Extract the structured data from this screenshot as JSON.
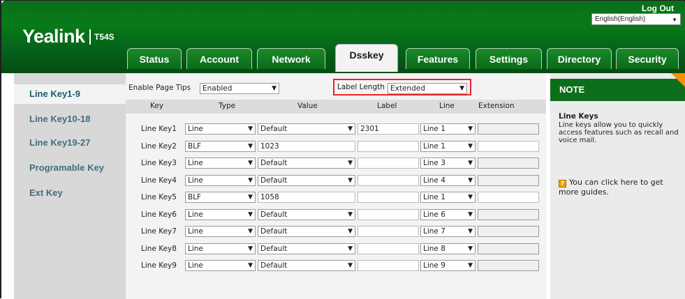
{
  "header": {
    "brand": "Yealink",
    "model": "T54S",
    "logout": "Log Out",
    "language": "English(English)"
  },
  "tabs": [
    {
      "label": "Status"
    },
    {
      "label": "Account"
    },
    {
      "label": "Network"
    },
    {
      "label": "Dsskey",
      "active": true
    },
    {
      "label": "Features"
    },
    {
      "label": "Settings"
    },
    {
      "label": "Directory"
    },
    {
      "label": "Security"
    }
  ],
  "sidebar": {
    "items": [
      {
        "label": "Line Key1-9",
        "active": true
      },
      {
        "label": "Line Key10-18"
      },
      {
        "label": "Line Key19-27"
      },
      {
        "label": "Programable Key"
      },
      {
        "label": "Ext Key"
      }
    ]
  },
  "settings": {
    "page_tips_label": "Enable Page Tips",
    "page_tips_value": "Enabled",
    "label_length_label": "Label Length",
    "label_length_value": "Extended"
  },
  "table": {
    "headers": [
      "Key",
      "Type",
      "Value",
      "Label",
      "Line",
      "Extension"
    ],
    "rows": [
      {
        "key": "Line Key1",
        "type": "Line",
        "value": "Default",
        "value_select": true,
        "label": "2301",
        "line": "Line 1",
        "ext_disabled": true
      },
      {
        "key": "Line Key2",
        "type": "BLF",
        "value": "1023",
        "value_select": false,
        "label": "",
        "line": "Line 1",
        "ext_disabled": false
      },
      {
        "key": "Line Key3",
        "type": "Line",
        "value": "Default",
        "value_select": true,
        "label": "",
        "line": "Line 3",
        "ext_disabled": true
      },
      {
        "key": "Line Key4",
        "type": "Line",
        "value": "Default",
        "value_select": true,
        "label": "",
        "line": "Line 4",
        "ext_disabled": true
      },
      {
        "key": "Line Key5",
        "type": "BLF",
        "value": "1058",
        "value_select": false,
        "label": "",
        "line": "Line 1",
        "ext_disabled": false
      },
      {
        "key": "Line Key6",
        "type": "Line",
        "value": "Default",
        "value_select": true,
        "label": "",
        "line": "Line 6",
        "ext_disabled": true
      },
      {
        "key": "Line Key7",
        "type": "Line",
        "value": "Default",
        "value_select": true,
        "label": "",
        "line": "Line 7",
        "ext_disabled": true
      },
      {
        "key": "Line Key8",
        "type": "Line",
        "value": "Default",
        "value_select": true,
        "label": "",
        "line": "Line 8",
        "ext_disabled": true
      },
      {
        "key": "Line Key9",
        "type": "Line",
        "value": "Default",
        "value_select": true,
        "label": "",
        "line": "Line 9",
        "ext_disabled": true
      }
    ]
  },
  "note": {
    "heading": "NOTE",
    "title": "Line Keys",
    "body": "Line keys allow you to quickly access features such as recall and voice mail.",
    "guide": "You can click here to get more guides.",
    "guide_icon": "question-icon"
  }
}
